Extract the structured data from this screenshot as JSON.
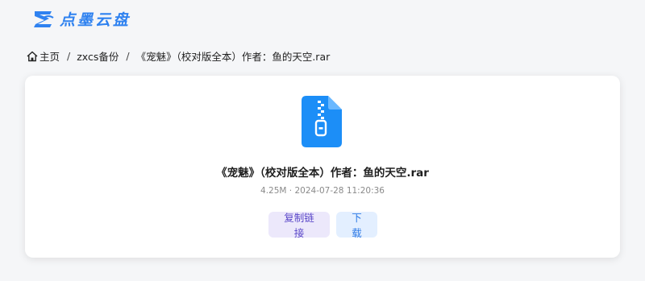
{
  "brand": {
    "name": "点墨云盘",
    "logo_icon": "dianmo-logo-icon",
    "color": "#2f82f0"
  },
  "breadcrumb": {
    "home_icon": "home-icon",
    "home": "主页",
    "separator": "/",
    "folder": "zxcs备份",
    "current": "《宠魅》（校对版全本）作者：鱼的天空.rar"
  },
  "file": {
    "icon": "zip-file-icon",
    "icon_color": "#1c8ef7",
    "name": "《宠魅》（校对版全本）作者：鱼的天空.rar",
    "meta": "4.25M · 2024-07-28 11:20:36"
  },
  "actions": {
    "copy_link": "复制链接",
    "download": "下载",
    "copy_color": "#5a47c8",
    "download_color": "#2f7be6"
  }
}
